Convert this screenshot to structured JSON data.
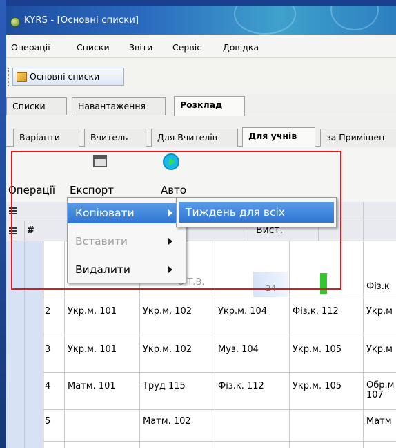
{
  "window": {
    "title": "KYRS - [Основні списки]"
  },
  "menubar": {
    "items": [
      "Операції",
      "Списки",
      "Звіти",
      "Сервіс",
      "Довідка"
    ]
  },
  "toolbar": {
    "open_lists_label": "Основні списки"
  },
  "main_tabs": [
    "Списки",
    "Навантаження",
    "Розклад"
  ],
  "main_tabs_active": "Розклад",
  "sub_tabs": [
    "Варіанти",
    "Вчитель",
    "Для Вчителів",
    "Для учнів",
    "за Приміщен"
  ],
  "sub_tabs_active": "Для учнів",
  "ops_toolbar": {
    "operations_label": "Операції",
    "export_label": "Експорт",
    "auto_label": "Авто"
  },
  "context_menu": {
    "copy": "Копіювати",
    "paste": "Вставити",
    "delete": "Видалити",
    "submenu_week_all": "Тиждень для всіх"
  },
  "grid": {
    "header_number": "#",
    "header_vyst": "Вист.",
    "teacher_partial": "О Т.В.",
    "busy_value": "24",
    "rows": [
      {
        "num": "",
        "c1": "",
        "c2": "",
        "c3": "",
        "c4": "",
        "c5": "Фіз.к"
      },
      {
        "num": "2",
        "c1": "Укр.м. 101",
        "c2": "Укр.м. 102",
        "c3": "Укр.м. 104",
        "c4": "Фіз.к. 112",
        "c5": "Укр.м"
      },
      {
        "num": "3",
        "c1": "Укр.м. 101",
        "c2": "Укр.м. 102",
        "c3": "Муз. 104",
        "c4": "Укр.м. 105",
        "c5": "Укр.м"
      },
      {
        "num": "4",
        "c1": "Матм. 101",
        "c2": "Труд 115",
        "c3": "Фіз.к. 112",
        "c4": "Укр.м. 105",
        "c5": "Обр.м\n107"
      },
      {
        "num": "5",
        "c1": "",
        "c2": "Матм. 102",
        "c3": "",
        "c4": "",
        "c5": "Матм"
      }
    ]
  },
  "colors": {
    "highlight_frame": "#e0181c",
    "menu_selection": "#3a80d8",
    "status_green": "#36c433"
  }
}
